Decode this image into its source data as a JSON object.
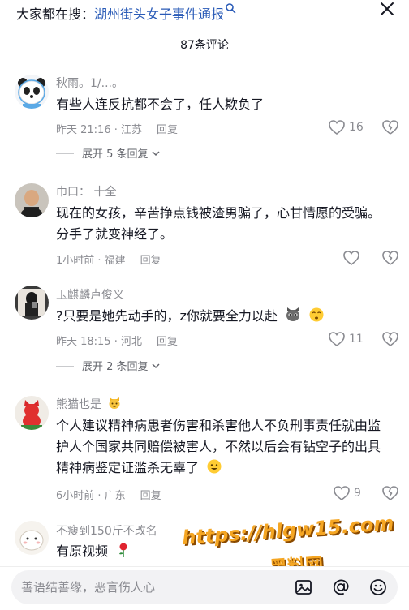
{
  "search_bar": {
    "label": "大家都在搜：",
    "keyword": "湖州街头女子事件通报"
  },
  "comment_count": "87条评论",
  "comments": [
    {
      "username": "秋雨。1/...。",
      "text": "有些人连反抗都不会了，任人欺负了",
      "time": "昨天 21:16 · 江苏",
      "reply": "回复",
      "likes": "16",
      "expand": "展开 5 条回复"
    },
    {
      "username": "巾口： 十全",
      "text": "现在的女孩，辛苦挣点钱被渣男骗了，心甘情愿的受骗。分手了就变神经了。",
      "time": "1小时前 · 福建",
      "reply": "回复",
      "likes": ""
    },
    {
      "username": "玉麒麟卢俊义",
      "text": "?只要是她先动手的，z你就要全力以赴",
      "time": "昨天 18:15 · 河北",
      "reply": "回复",
      "likes": "11",
      "expand": "展开 2 条回复"
    },
    {
      "username": "熊猫也是",
      "text": "个人建议精神病患者伤害和杀害他人不负刑事责任就由监护人个国家共同赔偿被害人，不然以后会有钻空子的出具精神病鉴定证滥杀无辜了",
      "time": "6小时前 · 广东",
      "reply": "回复",
      "likes": "9"
    },
    {
      "username": "不瘦到150斤不改名",
      "text": "有原视频"
    }
  ],
  "input": {
    "placeholder": "善语结善缘，恶言伤人心"
  },
  "watermark": {
    "url": "https://hlgw15.com",
    "site": "黑料网"
  },
  "colors": {
    "keyword": "#2a5bb7",
    "secondary_text": "#8a8b91",
    "watermark": "#f5a623"
  }
}
